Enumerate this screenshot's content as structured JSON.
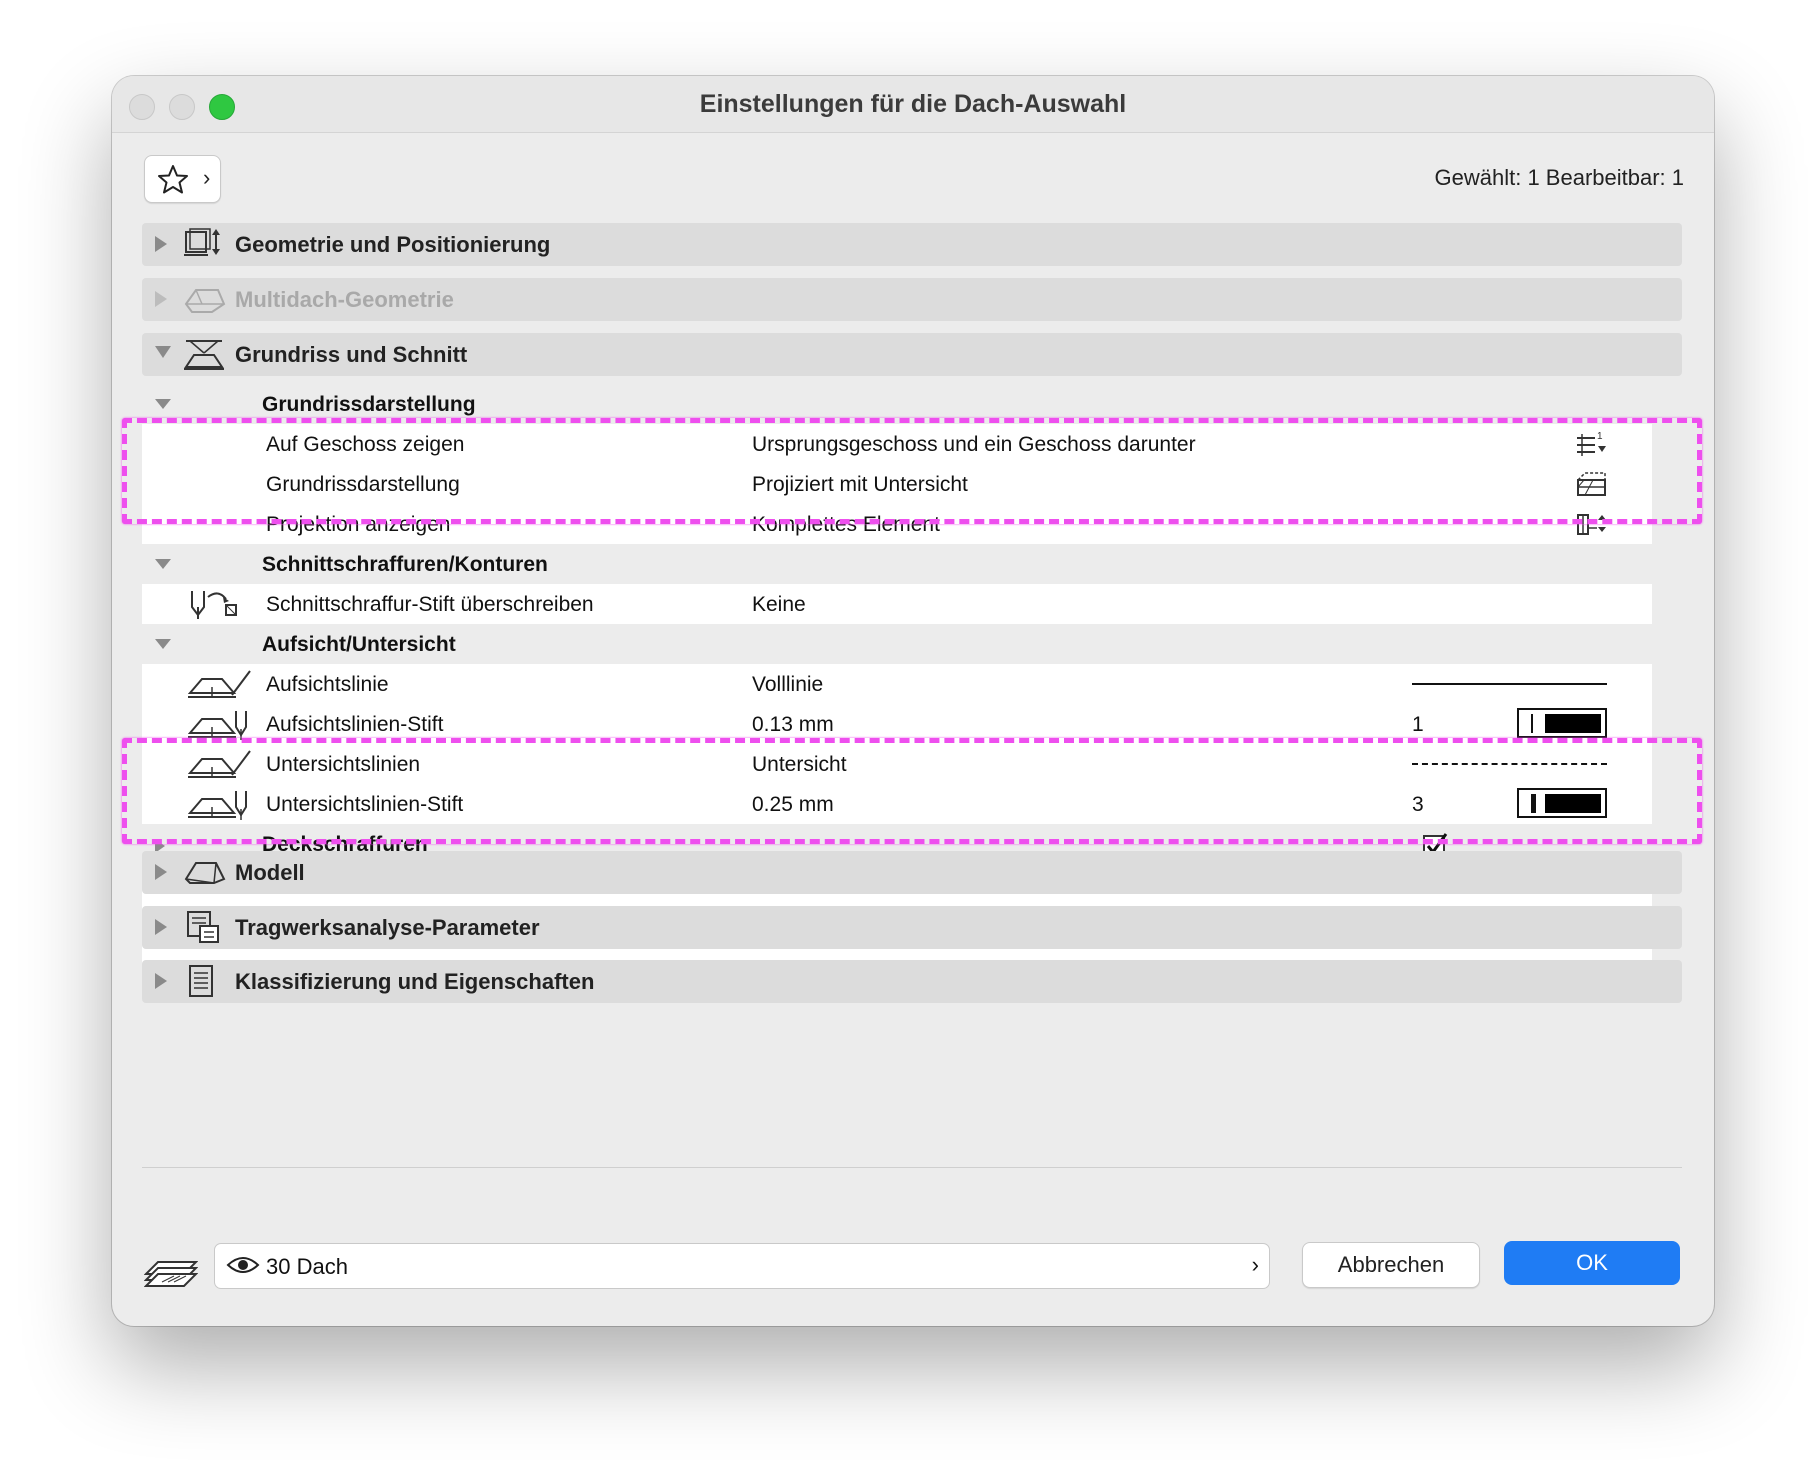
{
  "window": {
    "title": "Einstellungen für die Dach-Auswahl",
    "selection_info": "Gewählt: 1 Bearbeitbar: 1"
  },
  "sections_top": [
    {
      "label": "Geometrie und Positionierung",
      "icon": "geometry-icon",
      "expanded": false,
      "enabled": true
    },
    {
      "label": "Multidach-Geometrie",
      "icon": "multiroof-icon",
      "expanded": false,
      "enabled": false
    },
    {
      "label": "Grundriss und Schnitt",
      "icon": "floorplan-section-icon",
      "expanded": true,
      "enabled": true
    }
  ],
  "floorplan_panel": {
    "groups": [
      {
        "label": "Grundrissdarstellung",
        "rows": [
          {
            "name": "Auf Geschoss zeigen",
            "value": "Ursprungsgeschoss und ein Geschoss darunter",
            "icon": "story-display-icon"
          },
          {
            "name": "Grundrissdarstellung",
            "value": "Projiziert mit Untersicht",
            "icon": "projection-mode-icon"
          },
          {
            "name": "Projektion anzeigen",
            "value": "Komplettes Element",
            "icon": "show-projection-icon"
          }
        ]
      },
      {
        "label": "Schnittschraffuren/Konturen",
        "rows": [
          {
            "name": "Schnittschraffur-Stift überschreiben",
            "value": "Keine",
            "icon": "override-pen-icon"
          }
        ]
      },
      {
        "label": "Aufsicht/Untersicht",
        "rows": [
          {
            "name": "Aufsichtslinie",
            "value": "Volllinie",
            "line_style": "solid",
            "icon": "roof-line-icon"
          },
          {
            "name": "Aufsichtslinien-Stift",
            "value": "0.13 mm",
            "pen_number": "1",
            "icon": "roof-pen-icon"
          },
          {
            "name": "Untersichtslinien",
            "value": "Untersicht",
            "line_style": "dashed",
            "icon": "roof-line-icon"
          },
          {
            "name": "Untersichtslinien-Stift",
            "value": "0.25 mm",
            "pen_number": "3",
            "icon": "roof-pen-icon"
          }
        ]
      },
      {
        "label": "Deckschraffuren",
        "checked": true
      }
    ]
  },
  "sections_bottom": [
    {
      "label": "Modell",
      "icon": "model-icon"
    },
    {
      "label": "Tragwerksanalyse-Parameter",
      "icon": "structural-analysis-icon"
    },
    {
      "label": "Klassifizierung und Eigenschaften",
      "icon": "classification-icon"
    }
  ],
  "footer": {
    "layer_name": "30 Dach",
    "cancel_label": "Abbrechen",
    "ok_label": "OK"
  },
  "colors": {
    "highlight": "#ee4fee",
    "ok_button": "#1f7cf4",
    "maximize_button": "#2fc841"
  }
}
